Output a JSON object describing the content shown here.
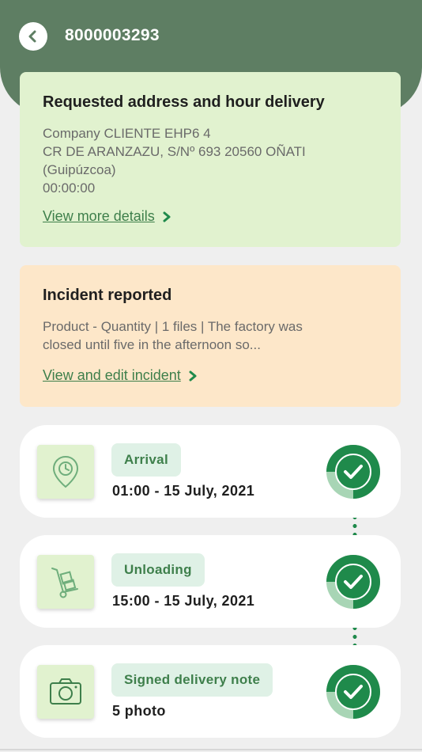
{
  "header": {
    "order_id": "8000003293"
  },
  "address_card": {
    "title": "Requested address and hour delivery",
    "company": "Company CLIENTE EHP6 4",
    "address_line": "CR DE ARANZAZU, S/Nº 693 20560 OÑATI",
    "region": "(Guipúzcoa)",
    "time": "00:00:00",
    "link_label": "View more details"
  },
  "incident_card": {
    "title": "Incident reported",
    "summary_line1": "Product - Quantity | 1 files | The factory was",
    "summary_line2": "closed until five in the afternoon so...",
    "link_label": "View and edit incident"
  },
  "steps": [
    {
      "label": "Arrival",
      "value": "01:00 - 15 July, 2021",
      "icon": "location-clock-icon",
      "status": "completed"
    },
    {
      "label": "Unloading",
      "value": "15:00 - 15 July, 2021",
      "icon": "hand-truck-icon",
      "status": "completed"
    },
    {
      "label": "Signed delivery note",
      "value": "5 photo",
      "icon": "camera-icon",
      "status": "completed"
    }
  ],
  "colors": {
    "header_bg": "#5e7e63",
    "address_card_bg": "#e1f2cf",
    "incident_card_bg": "#fde7c9",
    "accent_green": "#1f8a4b",
    "link_green": "#3e7f4b"
  }
}
